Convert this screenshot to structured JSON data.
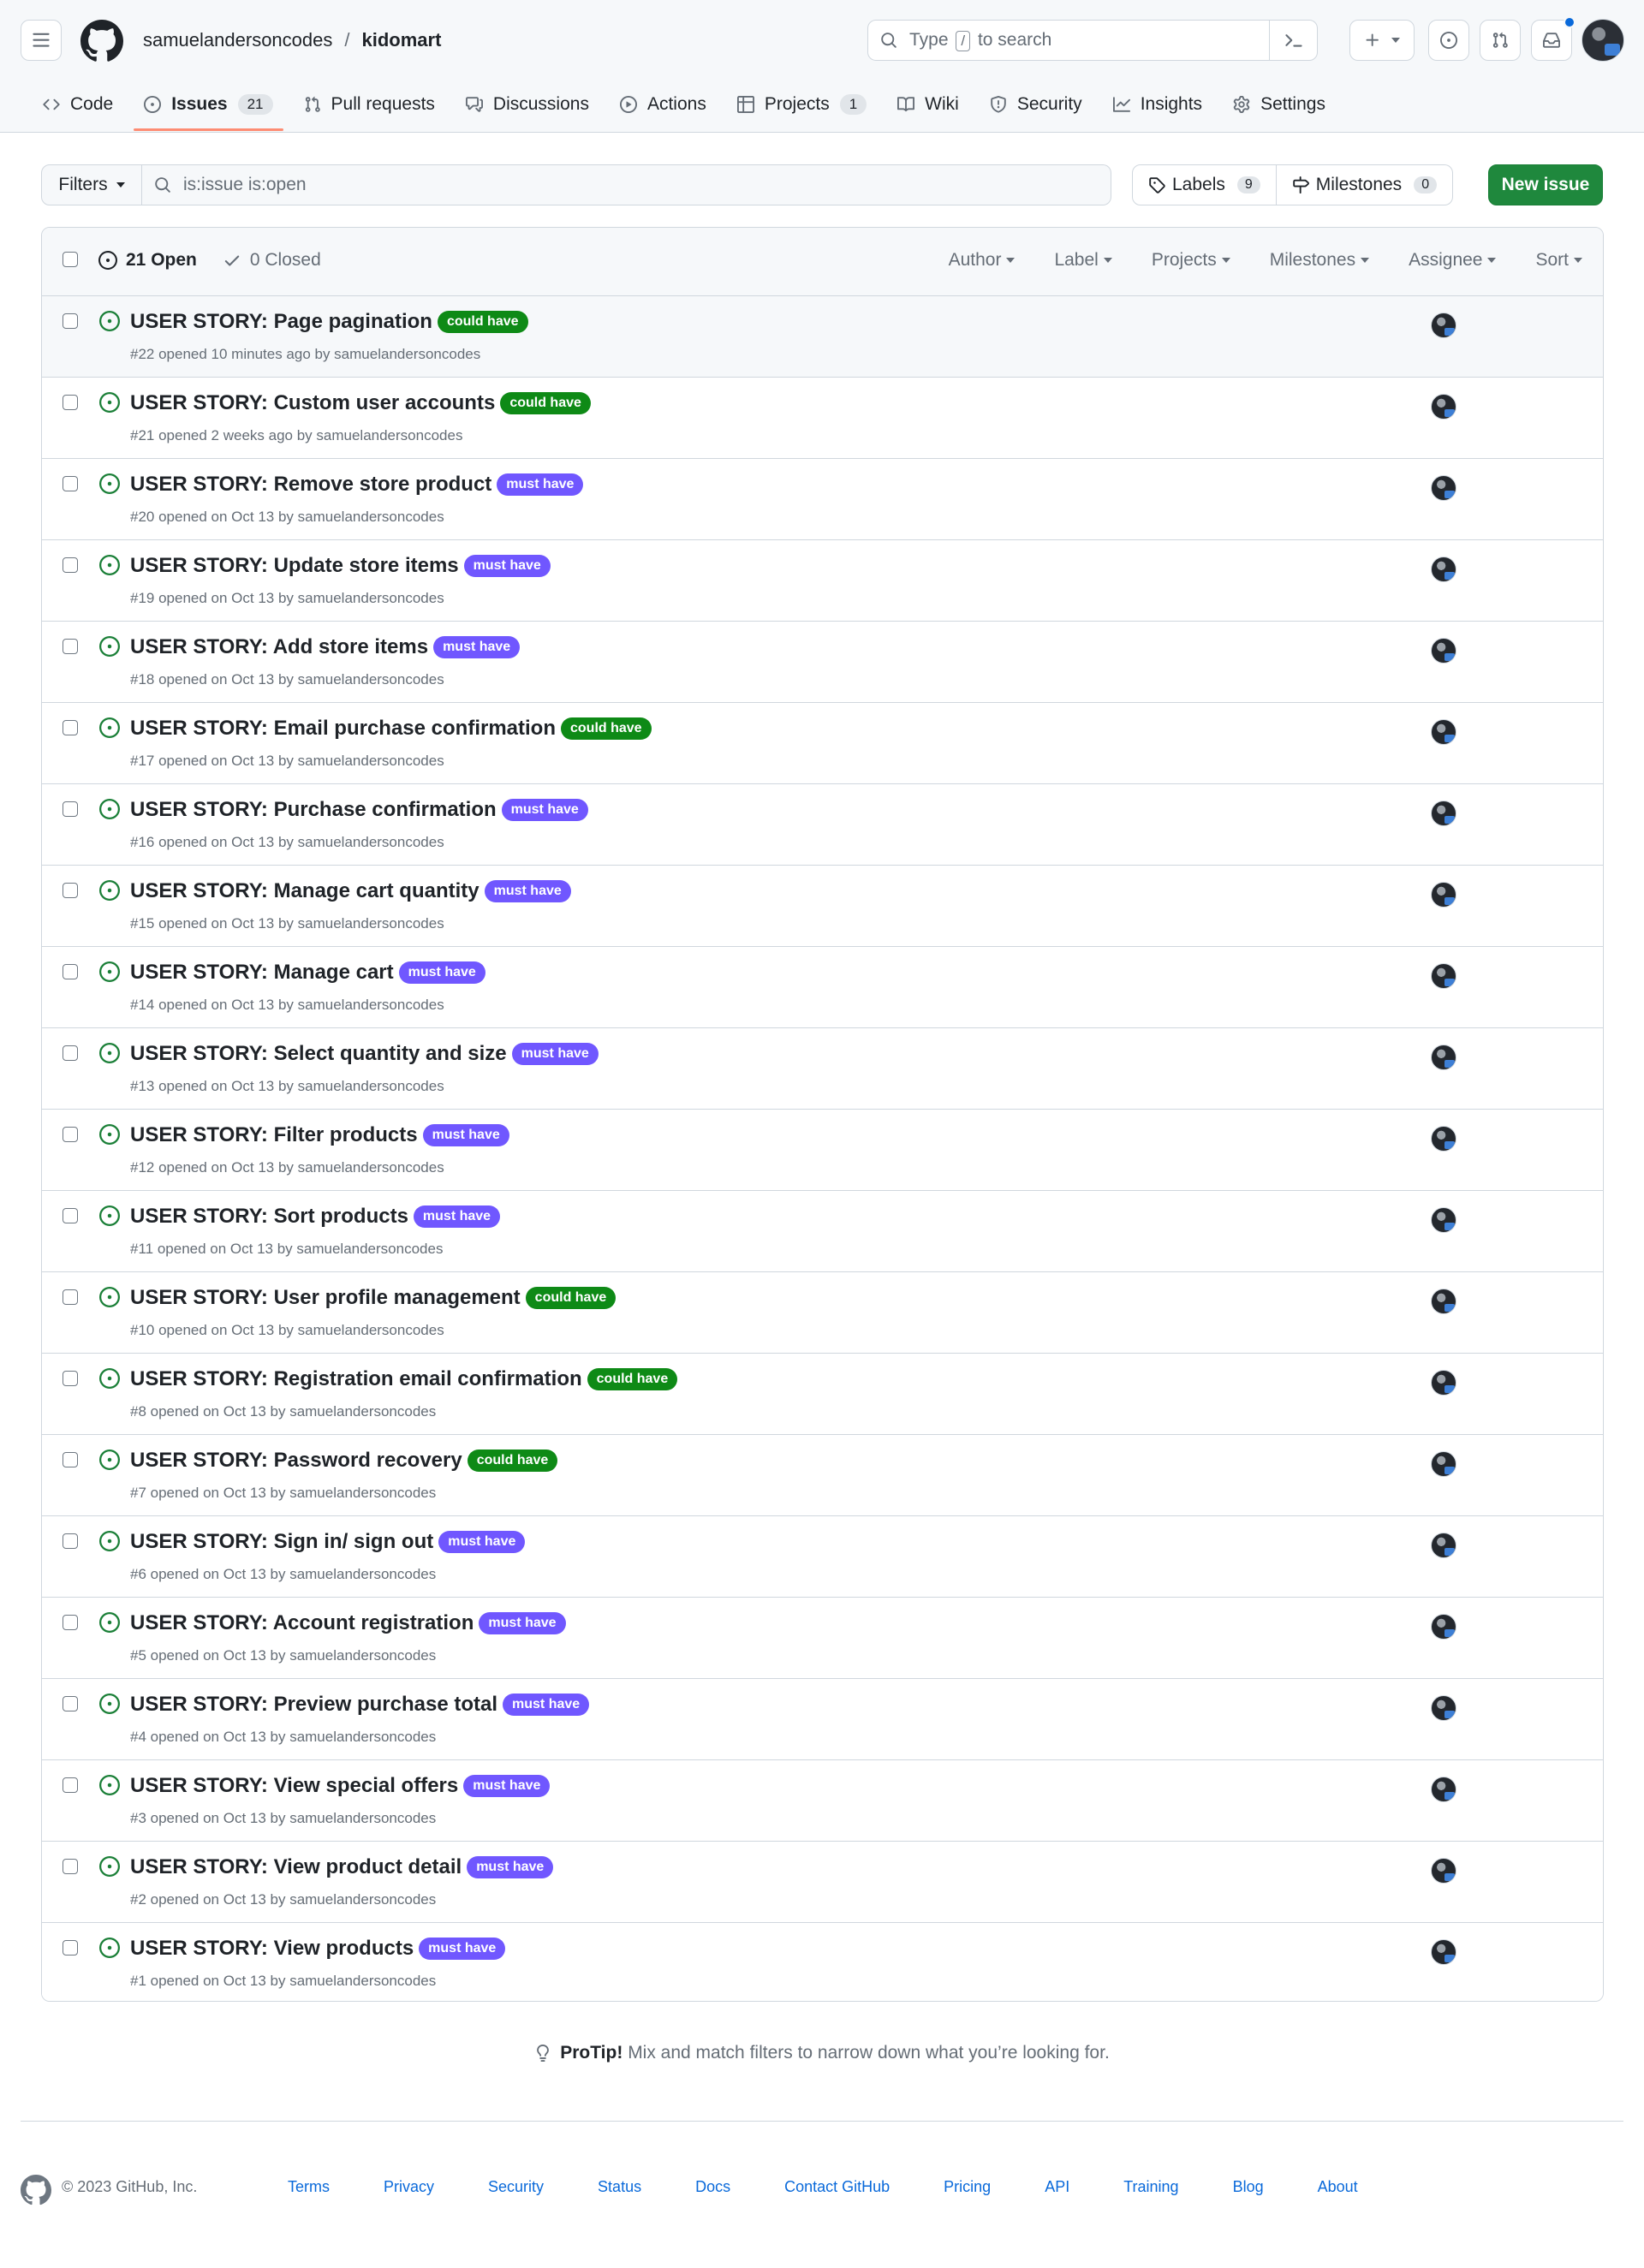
{
  "header": {
    "owner": "samuelandersoncodes",
    "separator": "/",
    "repo": "kidomart",
    "search_pre": "Type",
    "search_key": "/",
    "search_post": "to search"
  },
  "nav": [
    {
      "label": "Code",
      "icon": "code-icon"
    },
    {
      "label": "Issues",
      "icon": "issue-icon",
      "count": "21",
      "active": true
    },
    {
      "label": "Pull requests",
      "icon": "pull-request-icon"
    },
    {
      "label": "Discussions",
      "icon": "discussions-icon"
    },
    {
      "label": "Actions",
      "icon": "play-icon"
    },
    {
      "label": "Projects",
      "icon": "table-icon",
      "count": "1"
    },
    {
      "label": "Wiki",
      "icon": "book-icon"
    },
    {
      "label": "Security",
      "icon": "shield-icon"
    },
    {
      "label": "Insights",
      "icon": "graph-icon"
    },
    {
      "label": "Settings",
      "icon": "gear-icon"
    }
  ],
  "toolbar": {
    "filters_label": "Filters",
    "filter_value": "is:issue is:open",
    "labels_label": "Labels",
    "labels_count": "9",
    "milestones_label": "Milestones",
    "milestones_count": "0",
    "new_issue_label": "New issue"
  },
  "list_header": {
    "open_label": "21 Open",
    "closed_label": "0 Closed",
    "filters": [
      "Author",
      "Label",
      "Projects",
      "Milestones",
      "Assignee",
      "Sort"
    ]
  },
  "labels": {
    "could_have": {
      "text": "could have",
      "bg": "#0e8a16",
      "fg": "#ffffff"
    },
    "must_have": {
      "text": "must have",
      "bg": "#7057ff",
      "fg": "#ffffff"
    }
  },
  "issues": [
    {
      "title": "USER STORY: Page pagination",
      "label": "could_have",
      "meta": "#22 opened 10 minutes ago by samuelandersoncodes"
    },
    {
      "title": "USER STORY: Custom user accounts",
      "label": "could_have",
      "meta": "#21 opened 2 weeks ago by samuelandersoncodes"
    },
    {
      "title": "USER STORY: Remove store product",
      "label": "must_have",
      "meta": "#20 opened on Oct 13 by samuelandersoncodes"
    },
    {
      "title": "USER STORY: Update store items",
      "label": "must_have",
      "meta": "#19 opened on Oct 13 by samuelandersoncodes"
    },
    {
      "title": "USER STORY: Add store items",
      "label": "must_have",
      "meta": "#18 opened on Oct 13 by samuelandersoncodes"
    },
    {
      "title": "USER STORY: Email purchase confirmation",
      "label": "could_have",
      "meta": "#17 opened on Oct 13 by samuelandersoncodes"
    },
    {
      "title": "USER STORY: Purchase confirmation",
      "label": "must_have",
      "meta": "#16 opened on Oct 13 by samuelandersoncodes"
    },
    {
      "title": "USER STORY: Manage cart quantity",
      "label": "must_have",
      "meta": "#15 opened on Oct 13 by samuelandersoncodes"
    },
    {
      "title": "USER STORY: Manage cart",
      "label": "must_have",
      "meta": "#14 opened on Oct 13 by samuelandersoncodes"
    },
    {
      "title": "USER STORY: Select quantity and size",
      "label": "must_have",
      "meta": "#13 opened on Oct 13 by samuelandersoncodes"
    },
    {
      "title": "USER STORY: Filter products",
      "label": "must_have",
      "meta": "#12 opened on Oct 13 by samuelandersoncodes"
    },
    {
      "title": "USER STORY: Sort products",
      "label": "must_have",
      "meta": "#11 opened on Oct 13 by samuelandersoncodes"
    },
    {
      "title": "USER STORY: User profile management",
      "label": "could_have",
      "meta": "#10 opened on Oct 13 by samuelandersoncodes"
    },
    {
      "title": "USER STORY: Registration email confirmation",
      "label": "could_have",
      "meta": "#8 opened on Oct 13 by samuelandersoncodes"
    },
    {
      "title": "USER STORY: Password recovery",
      "label": "could_have",
      "meta": "#7 opened on Oct 13 by samuelandersoncodes"
    },
    {
      "title": "USER STORY: Sign in/ sign out",
      "label": "must_have",
      "meta": "#6 opened on Oct 13 by samuelandersoncodes"
    },
    {
      "title": "USER STORY: Account registration",
      "label": "must_have",
      "meta": "#5 opened on Oct 13 by samuelandersoncodes"
    },
    {
      "title": "USER STORY: Preview purchase total",
      "label": "must_have",
      "meta": "#4 opened on Oct 13 by samuelandersoncodes"
    },
    {
      "title": "USER STORY: View special offers",
      "label": "must_have",
      "meta": "#3 opened on Oct 13 by samuelandersoncodes"
    },
    {
      "title": "USER STORY: View product detail",
      "label": "must_have",
      "meta": "#2 opened on Oct 13 by samuelandersoncodes"
    },
    {
      "title": "USER STORY: View products",
      "label": "must_have",
      "meta": "#1 opened on Oct 13 by samuelandersoncodes"
    }
  ],
  "protip": {
    "bold": "ProTip!",
    "text": "Mix and match filters to narrow down what you’re looking for."
  },
  "footer": {
    "copyright": "© 2023 GitHub, Inc.",
    "links": [
      "Terms",
      "Privacy",
      "Security",
      "Status",
      "Docs",
      "Contact GitHub",
      "Pricing",
      "API",
      "Training",
      "Blog",
      "About"
    ]
  },
  "colors": {
    "open_green": "#1a7f37",
    "primary_button": "#1f883d",
    "active_tab_underline": "#fd8c73",
    "link_blue": "#0969da"
  }
}
